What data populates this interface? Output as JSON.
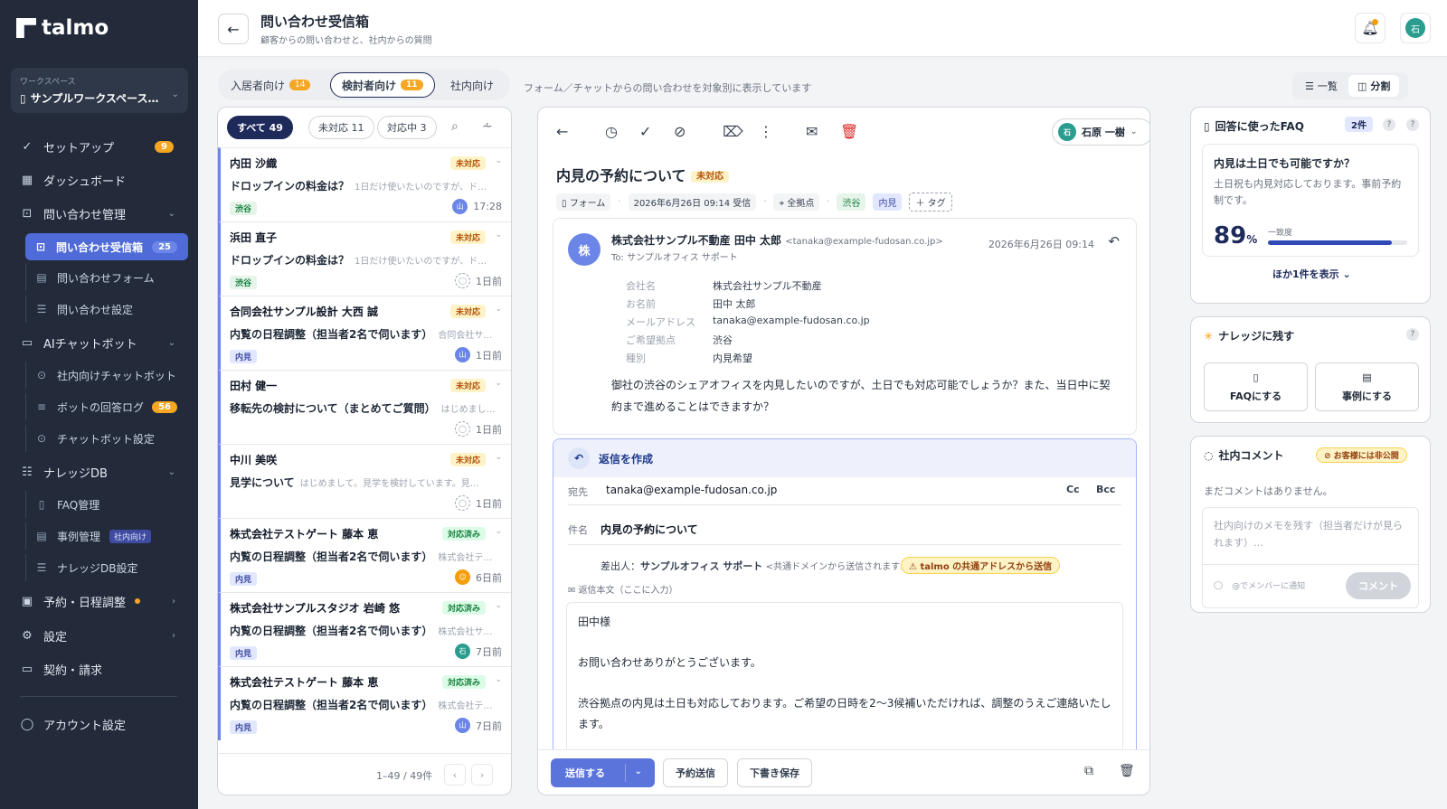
{
  "sidebar": {
    "logo": "talmo",
    "workspace_label": "ワークスペース",
    "workspace_name": "サンプルワークスペース…",
    "items": [
      {
        "label": "セットアップ",
        "badge": "9"
      },
      {
        "label": "ダッシュボード"
      },
      {
        "label": "問い合わせ管理"
      },
      {
        "label": "問い合わせ受信箱",
        "badge": "25"
      },
      {
        "label": "問い合わせフォーム"
      },
      {
        "label": "問い合わせ設定"
      },
      {
        "label": "AIチャットボット"
      },
      {
        "label": "社内向けチャットボット"
      },
      {
        "label": "ボットの回答ログ",
        "badge": "56"
      },
      {
        "label": "チャットボット設定"
      },
      {
        "label": "ナレッジDB"
      },
      {
        "label": "FAQ管理"
      },
      {
        "label": "事例管理",
        "tag": "社内向け"
      },
      {
        "label": "ナレッジDB設定"
      },
      {
        "label": "予約・日程調整"
      },
      {
        "label": "設定"
      },
      {
        "label": "契約・請求"
      },
      {
        "label": "アカウント設定"
      }
    ]
  },
  "header": {
    "title": "問い合わせ受信箱",
    "subtitle": "顧客からの問い合わせと、社内からの質問",
    "avatar": "石"
  },
  "tabs": [
    {
      "label": "入居者向け",
      "count": "14"
    },
    {
      "label": "検討者向け",
      "count": "11"
    },
    {
      "label": "社内向け",
      "count": ""
    }
  ],
  "tabs_desc": "フォーム／チャットからの問い合わせを対象別に表示しています",
  "view_toggle": {
    "list": "一覧",
    "split": "分割"
  },
  "filters": [
    {
      "label": "すべて",
      "count": "49"
    },
    {
      "label": "未対応",
      "count": "11"
    },
    {
      "label": "対応中",
      "count": "3"
    }
  ],
  "list": [
    {
      "name": "内田 沙織",
      "status": "未対応",
      "subject": "ドロップインの料金は？",
      "preview": "1日だけ使いたいのですが、ド…",
      "tag": "渋谷",
      "av": "山",
      "time": "17:28"
    },
    {
      "name": "浜田 直子",
      "status": "未対応",
      "subject": "ドロップインの料金は？",
      "preview": "1日だけ使いたいのですが、ド…",
      "tag": "渋谷",
      "av": "",
      "time": "1日前"
    },
    {
      "name": "合同会社サンプル設計 大西 誠",
      "status": "未対応",
      "subject": "内覧の日程調整（担当者2名で伺います）",
      "preview": "合同会社サ…",
      "tag": "内見",
      "av": "山",
      "time": "1日前"
    },
    {
      "name": "田村 健一",
      "status": "未対応",
      "subject": "移転先の検討について（まとめてご質問）",
      "preview": "はじめまし…",
      "tag": "",
      "av": "",
      "time": "1日前"
    },
    {
      "name": "中川 美咲",
      "status": "未対応",
      "subject": "見学について",
      "preview": "はじめまして。見学を検討しています。見…",
      "tag": "",
      "av": "",
      "time": "1日前"
    },
    {
      "name": "株式会社テストゲート 藤本 恵",
      "status": "対応済み",
      "subject": "内覧の日程調整（担当者2名で伺います）",
      "preview": "株式会社テ…",
      "tag": "内見",
      "av": "",
      "time": "6日前"
    },
    {
      "name": "株式会社サンプルスタジオ 岩崎 悠",
      "status": "対応済み",
      "subject": "内覧の日程調整（担当者2名で伺います）",
      "preview": "株式会社サ…",
      "tag": "内見",
      "av": "石",
      "time": "7日前"
    },
    {
      "name": "株式会社テストゲート 藤本 恵",
      "status": "対応済み",
      "subject": "内覧の日程調整（担当者2名で伺います）",
      "preview": "株式会社テ…",
      "tag": "内見",
      "av": "山",
      "time": "7日前"
    }
  ],
  "pagination": "1–49 / 49件",
  "detail": {
    "assignee_av": "石",
    "assignee": "石原 一樹",
    "title": "内見の予約について",
    "status": "未対応",
    "source": "フォーム",
    "received": "2026年6月26日 09:14 受信",
    "location": "全拠点",
    "tag1": "渋谷",
    "tag2": "内見",
    "add_tag": "＋ タグ",
    "from_av": "株",
    "from_name": "株式会社サンプル不動産 田中 太郎",
    "from_email": "<tanaka@example-fudosan.co.jp>",
    "to": "To: サンプルオフィス サポート",
    "date": "2026年6月26日 09:14",
    "fields": [
      {
        "k": "会社名",
        "v": "株式会社サンプル不動産"
      },
      {
        "k": "お名前",
        "v": "田中 太郎"
      },
      {
        "k": "メールアドレス",
        "v": "tanaka@example-fudosan.co.jp"
      },
      {
        "k": "ご希望拠点",
        "v": "渋谷"
      },
      {
        "k": "種別",
        "v": "内見希望"
      }
    ],
    "body_line1": "御社の渋谷のシェアオフィスを内見したいのですが、土日でも対応可能でしょうか？また、当日中に契",
    "body_line2": "約まで進めることはできますか？"
  },
  "reply": {
    "title": "返信を作成",
    "to_label": "宛先",
    "to": "tanaka@example-fudosan.co.jp",
    "cc": "Cc",
    "bcc": "Bcc",
    "subject_label": "件名",
    "subject": "内見の予約について",
    "sender_prefix": "差出人：",
    "sender_name": "サンプルオフィス サポート",
    "sender_note": "<共通ドメインから送信されます>",
    "warn": "talmo の共通アドレスから送信",
    "body_label": "返信本文（ここに入力）",
    "body_p1": "田中様",
    "body_p2": "お問い合わせありがとうございます。",
    "body_p3": "渋谷拠点の内見は土日も対応しております。ご希望の日時を2〜3候補いただければ、調整のうえご連絡いたします。",
    "send": "送信する",
    "schedule": "予約送信",
    "draft": "下書き保存"
  },
  "faq_panel": {
    "title": "回答に使ったFAQ",
    "count": "2件",
    "question": "内見は土日でも可能ですか？",
    "answer": "土日祝も内見対応しております。事前予約制です。",
    "score": "89",
    "score_unit": "%",
    "score_value": 0.89,
    "sim_label": "一致度",
    "show_more": "ほか1件を表示"
  },
  "knowledge_panel": {
    "title": "ナレッジに残す",
    "faq_btn": "FAQにする",
    "case_btn": "事例にする"
  },
  "comment_panel": {
    "title": "社内コメント",
    "private": "お客様には非公開",
    "empty": "まだコメントはありません。",
    "placeholder": "社内向けのメモを残す（担当者だけが見られます）…",
    "mention": "@でメンバーに通知",
    "submit": "コメント"
  },
  "colors": {
    "accent": "#5b74dc",
    "sidebar": "#232b3b",
    "warning": "#f5a623"
  }
}
